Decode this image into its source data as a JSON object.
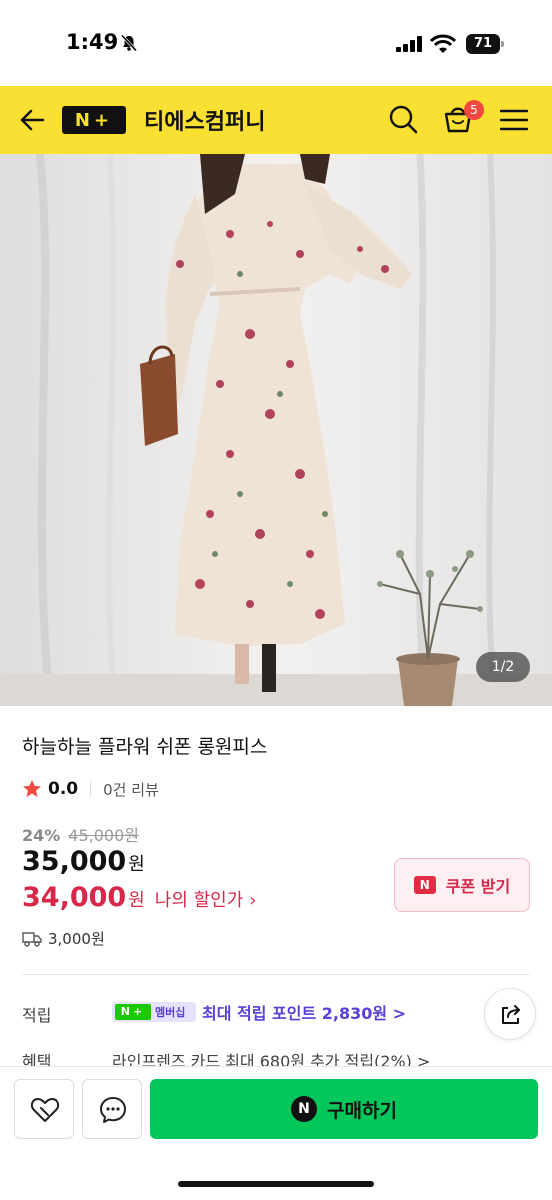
{
  "status_bar": {
    "time": "1:49",
    "battery": "71",
    "icons": [
      "bell-off-icon",
      "signal-icon",
      "wifi-icon",
      "battery-icon"
    ]
  },
  "header": {
    "logo_text": "N+",
    "store_name": "티에스컴퍼니",
    "cart_count": "5",
    "icons": [
      "back-arrow-icon",
      "search-icon",
      "cart-icon",
      "menu-icon"
    ],
    "colors": {
      "background": "#fae032",
      "logo_bg": "#111111"
    }
  },
  "hero": {
    "page_indicator": "1/2"
  },
  "product": {
    "title": "하늘하늘 플라워 쉬폰 롱원피스",
    "rating": "0.0",
    "review_count": "0건 리뷰",
    "discount_rate": "24%",
    "original_price": "45,000원",
    "sale_price": "35,000",
    "sale_unit": "원",
    "my_price": "34,000",
    "my_price_unit": "원",
    "my_price_label": "나의 할인가",
    "coupon_button": "쿠폰 받기",
    "coupon_badge": "N",
    "shipping_fee": "3,000원",
    "colors": {
      "accent": "#d8284a",
      "star": "#f2473f"
    }
  },
  "benefits": {
    "points_label": "적립",
    "membership_badge": "멤버십",
    "membership_logo": "N+",
    "points_text": "최대 적립 포인트 2,830원 >",
    "benefits_label": "혜택",
    "benefits_text": "라인프렌즈 카드 최대 680원 추가 적립(2%) >",
    "colors": {
      "points": "#5a3fd6"
    }
  },
  "bottom_bar": {
    "buy_label": "구매하기",
    "buy_badge": "N",
    "icons": [
      "wishlist-icon",
      "chat-icon"
    ],
    "colors": {
      "buy": "#03c75a"
    }
  }
}
